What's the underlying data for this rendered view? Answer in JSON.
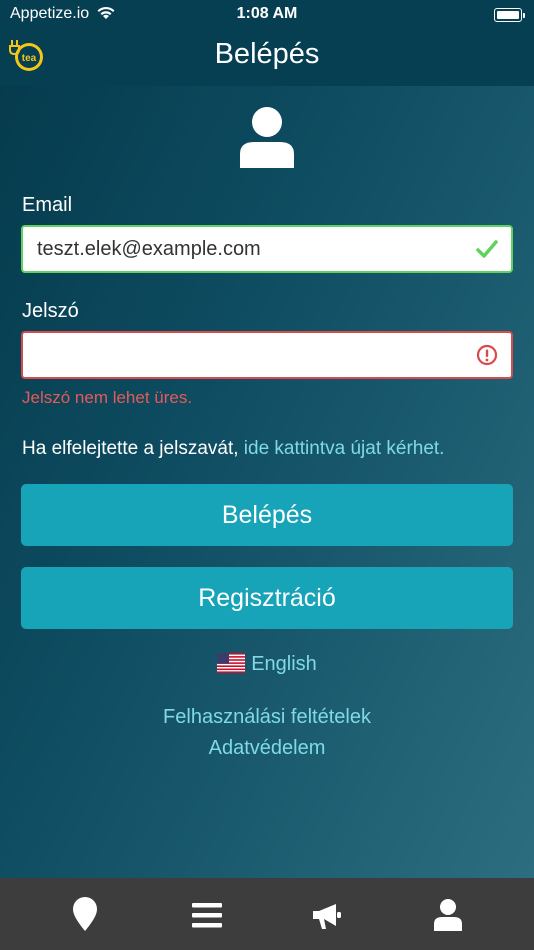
{
  "status_bar": {
    "carrier": "Appetize.io",
    "time": "1:08 AM"
  },
  "nav": {
    "title": "Belépés",
    "logo_text": "tea"
  },
  "form": {
    "email_label": "Email",
    "email_value": "teszt.elek@example.com",
    "password_label": "Jelszó",
    "password_value": "",
    "password_error": "Jelszó nem lehet üres.",
    "forgot_prefix": "Ha elfelejtette a jelszavát,",
    "forgot_link": "ide kattintva újat kérhet."
  },
  "buttons": {
    "login": "Belépés",
    "register": "Regisztráció"
  },
  "language": {
    "label": "English",
    "flag_icon": "us-flag-icon"
  },
  "links": {
    "terms": "Felhasználási feltételek",
    "privacy": "Adatvédelem"
  },
  "tabbar": {
    "icons": [
      "map-pin-icon",
      "menu-icon",
      "megaphone-icon",
      "user-icon"
    ]
  },
  "colors": {
    "accent": "#17a3b8",
    "link": "#7fd9e8",
    "valid": "#5fd25f",
    "error": "#d94a4a"
  }
}
